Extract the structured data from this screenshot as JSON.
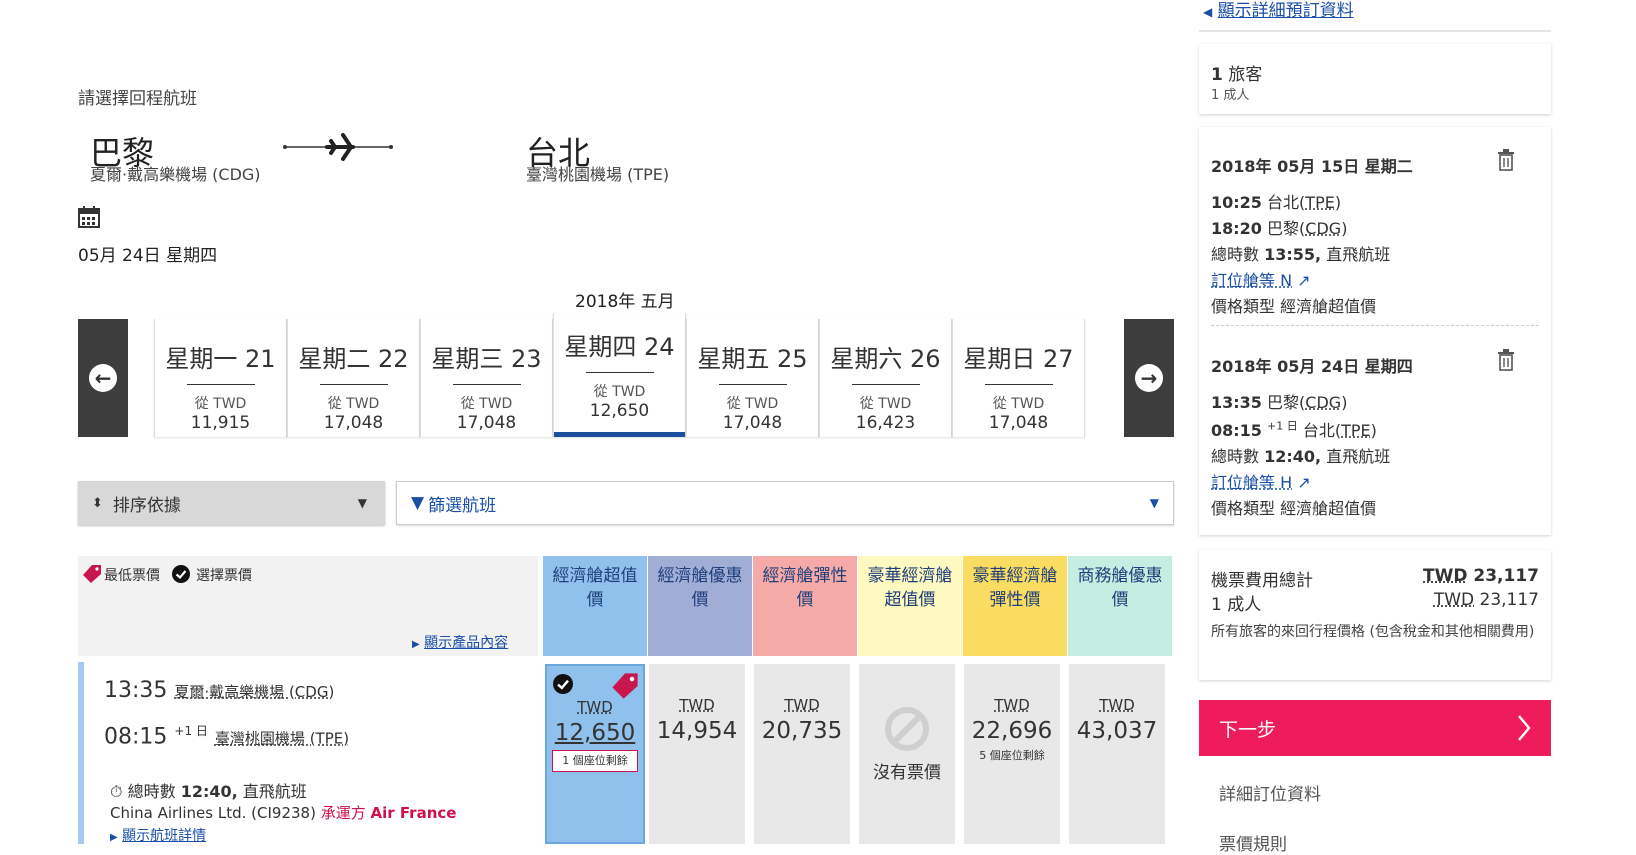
{
  "sidebar_top_link": "顯示詳細預訂資料",
  "instruction": "請選擇回程航班",
  "route": {
    "origin_city": "巴黎",
    "origin_airport": "夏爾·戴高樂機場 (CDG)",
    "dest_city": "台北",
    "dest_airport": "臺灣桃園機場 (TPE)"
  },
  "selected_date": "05月 24日 星期四",
  "month_label": "2018年 五月",
  "days": [
    {
      "label": "星期一 21",
      "from": "從 TWD",
      "price": "11,915"
    },
    {
      "label": "星期二 22",
      "from": "從 TWD",
      "price": "17,048"
    },
    {
      "label": "星期三 23",
      "from": "從 TWD",
      "price": "17,048"
    },
    {
      "label": "星期四 24",
      "from": "從 TWD",
      "price": "12,650"
    },
    {
      "label": "星期五 25",
      "from": "從 TWD",
      "price": "17,048"
    },
    {
      "label": "星期六 26",
      "from": "從 TWD",
      "price": "16,423"
    },
    {
      "label": "星期日 27",
      "from": "從 TWD",
      "price": "17,048"
    }
  ],
  "sort_label": "排序依據",
  "filter_label": "篩選航班",
  "legend": {
    "lowest": "最低票價",
    "selected": "選擇票價",
    "show_products": "顯示產品內容"
  },
  "fare_columns": [
    {
      "name": "經濟艙超值價",
      "color": "#8fc1ec"
    },
    {
      "name": "經濟艙優惠價",
      "color": "#a0aed6"
    },
    {
      "name": "經濟艙彈性價",
      "color": "#f5aaa8"
    },
    {
      "name": "豪華經濟艙超值價",
      "color": "#fdf9c0"
    },
    {
      "name": "豪華經濟艙彈性價",
      "color": "#fbdc63"
    },
    {
      "name": "商務艙優惠價",
      "color": "#c5ede1"
    }
  ],
  "flight": {
    "dep_time": "13:35",
    "dep_airport": "夏爾·戴高樂機場 (CDG)",
    "arr_time": "08:15",
    "arr_offset": "+1 日",
    "arr_airport": "臺灣桃園機場 (TPE)",
    "duration_prefix": "總時數",
    "duration": "12:40,",
    "nonstop": "直飛航班",
    "carrier": "China Airlines Ltd. (CI9238)",
    "operated_by": "承運方",
    "operator": "Air France",
    "details_link": "顯示航班詳情",
    "fares": [
      {
        "currency": "TWD",
        "amount": "12,650",
        "note": "1 個座位剩餘"
      },
      {
        "currency": "TWD",
        "amount": "14,954"
      },
      {
        "currency": "TWD",
        "amount": "20,735"
      },
      {
        "none": "沒有票價"
      },
      {
        "currency": "TWD",
        "amount": "22,696",
        "note": "5 個座位剩餘"
      },
      {
        "currency": "TWD",
        "amount": "43,037"
      }
    ]
  },
  "summary": {
    "travelers_count": "1",
    "travelers_label": "旅客",
    "adults": "1 成人",
    "outbound": {
      "date": "2018年 05月 15日 星期二",
      "dep_time": "10:25",
      "dep_city": "台北",
      "dep_code": "TPE",
      "arr_time": "18:20",
      "arr_city": "巴黎",
      "arr_code": "CDG",
      "duration_label": "總時數",
      "duration": "13:55,",
      "nonstop": "直飛航班",
      "booking_class": "訂位艙等 N",
      "fare_type_label": "價格類型",
      "fare_type": "經濟艙超值價"
    },
    "inbound": {
      "date": "2018年 05月 24日 星期四",
      "dep_time": "13:35",
      "dep_city": "巴黎",
      "dep_code": "CDG",
      "arr_time": "08:15",
      "arr_offset": "+1 日",
      "arr_city": "台北",
      "arr_code": "TPE",
      "duration_label": "總時數",
      "duration": "12:40,",
      "nonstop": "直飛航班",
      "booking_class": "訂位艙等 H",
      "fare_type_label": "價格類型",
      "fare_type": "經濟艙超值價"
    },
    "total_label": "機票費用總計",
    "total_currency": "TWD",
    "total_amount": "23,117",
    "adult_line": "1 成人",
    "adult_currency": "TWD",
    "adult_amount": "23,117",
    "note": "所有旅客的來回行程價格 (包含稅金和其他相關費用)"
  },
  "next_button": "下一步",
  "side_links": [
    "詳細訂位資料",
    "票價規則"
  ],
  "colors": {
    "accent": "#ee1c5b",
    "selected_bar": "#1b4f9c",
    "link": "#1a4ea8",
    "operator": "#d0104c",
    "lowest_tag": "#c8174f"
  }
}
